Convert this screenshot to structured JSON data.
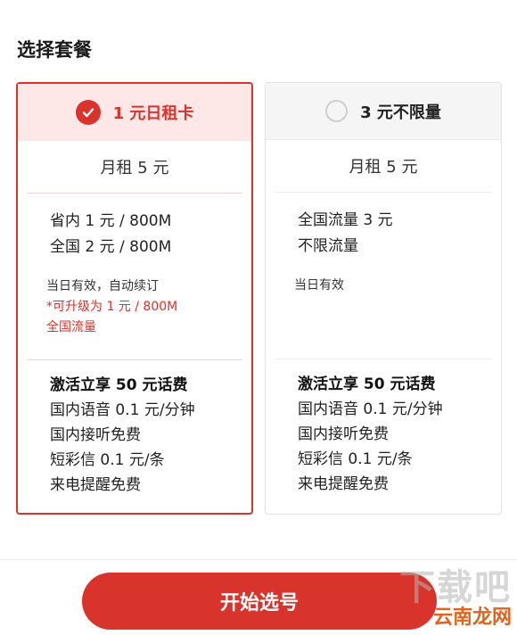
{
  "page": {
    "title": "选择套餐"
  },
  "plans": [
    {
      "name": "1 元日租卡",
      "selected": true,
      "price": "月租 5 元",
      "data_lines": [
        "省内 1 元 / 800M",
        "全国 2 元 / 800M"
      ],
      "note": "当日有效，自动续订",
      "red_note_lines": [
        "*可升级为 1 元 / 800M",
        "全国流量"
      ],
      "benefit_title": "激活立享 50 元话费",
      "benefits": [
        "国内语音 0.1 元/分钟",
        "国内接听免费",
        "短彩信 0.1 元/条",
        "来电提醒免费"
      ]
    },
    {
      "name": "3 元不限量",
      "selected": false,
      "price": "月租 5 元",
      "data_lines": [
        "全国流量 3 元",
        "不限流量"
      ],
      "note": "当日有效",
      "benefit_title": "激活立享 50 元话费",
      "benefits": [
        "国内语音 0.1 元/分钟",
        "国内接听免费",
        "短彩信 0.1 元/条",
        "来电提醒免费"
      ]
    }
  ],
  "footer": {
    "button_label": "开始选号"
  },
  "watermark": {
    "top": "下载吧",
    "bottom": "云南龙网"
  },
  "colors": {
    "accent": "#d9342b",
    "selected_header_bg": "#fde7e7"
  }
}
